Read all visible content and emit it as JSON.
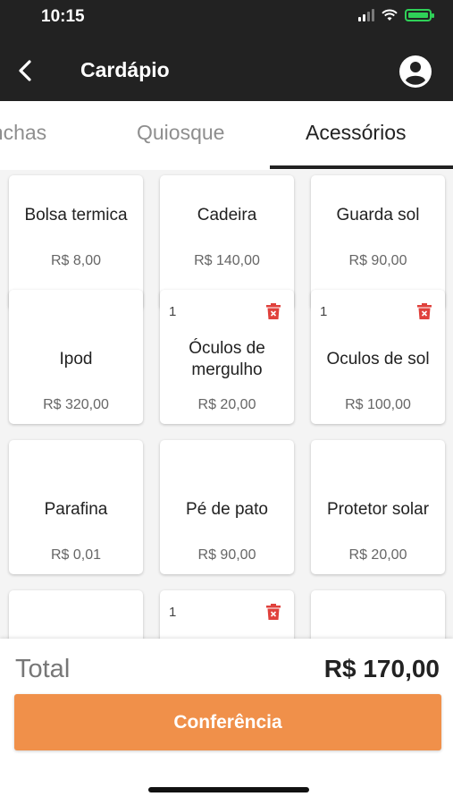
{
  "status_bar": {
    "time": "10:15"
  },
  "header": {
    "title": "Cardápio",
    "back_icon": "chevron-left-icon",
    "account_icon": "account-circle-icon"
  },
  "tabs": [
    {
      "label": "Pranchas",
      "active": false
    },
    {
      "label": "Quiosque",
      "active": false
    },
    {
      "label": "Acessórios",
      "active": true
    }
  ],
  "products": [
    {
      "name": "Bolsa termica",
      "price": "R$ 8,00"
    },
    {
      "name": "Cadeira",
      "price": "R$ 140,00"
    },
    {
      "name": "Guarda sol",
      "price": "R$ 90,00"
    },
    {
      "name": "Ipod",
      "price": "R$ 320,00"
    },
    {
      "name": "Óculos de mergulho",
      "price": "R$ 20,00",
      "qty": "1"
    },
    {
      "name": "Oculos de sol",
      "price": "R$ 100,00",
      "qty": "1"
    },
    {
      "name": "Parafina",
      "price": "R$ 0,01"
    },
    {
      "name": "Pé de pato",
      "price": "R$ 90,00"
    },
    {
      "name": "Protetor solar",
      "price": "R$ 20,00"
    },
    {
      "name": "",
      "price": ""
    },
    {
      "name": "",
      "price": "",
      "qty": "1"
    },
    {
      "name": "",
      "price": ""
    }
  ],
  "footer": {
    "total_label": "Total",
    "total_value": "R$ 170,00",
    "confirm_label": "Conferência"
  },
  "colors": {
    "header_bg": "#222222",
    "accent": "#f0904a",
    "delete": "#e0413c"
  }
}
